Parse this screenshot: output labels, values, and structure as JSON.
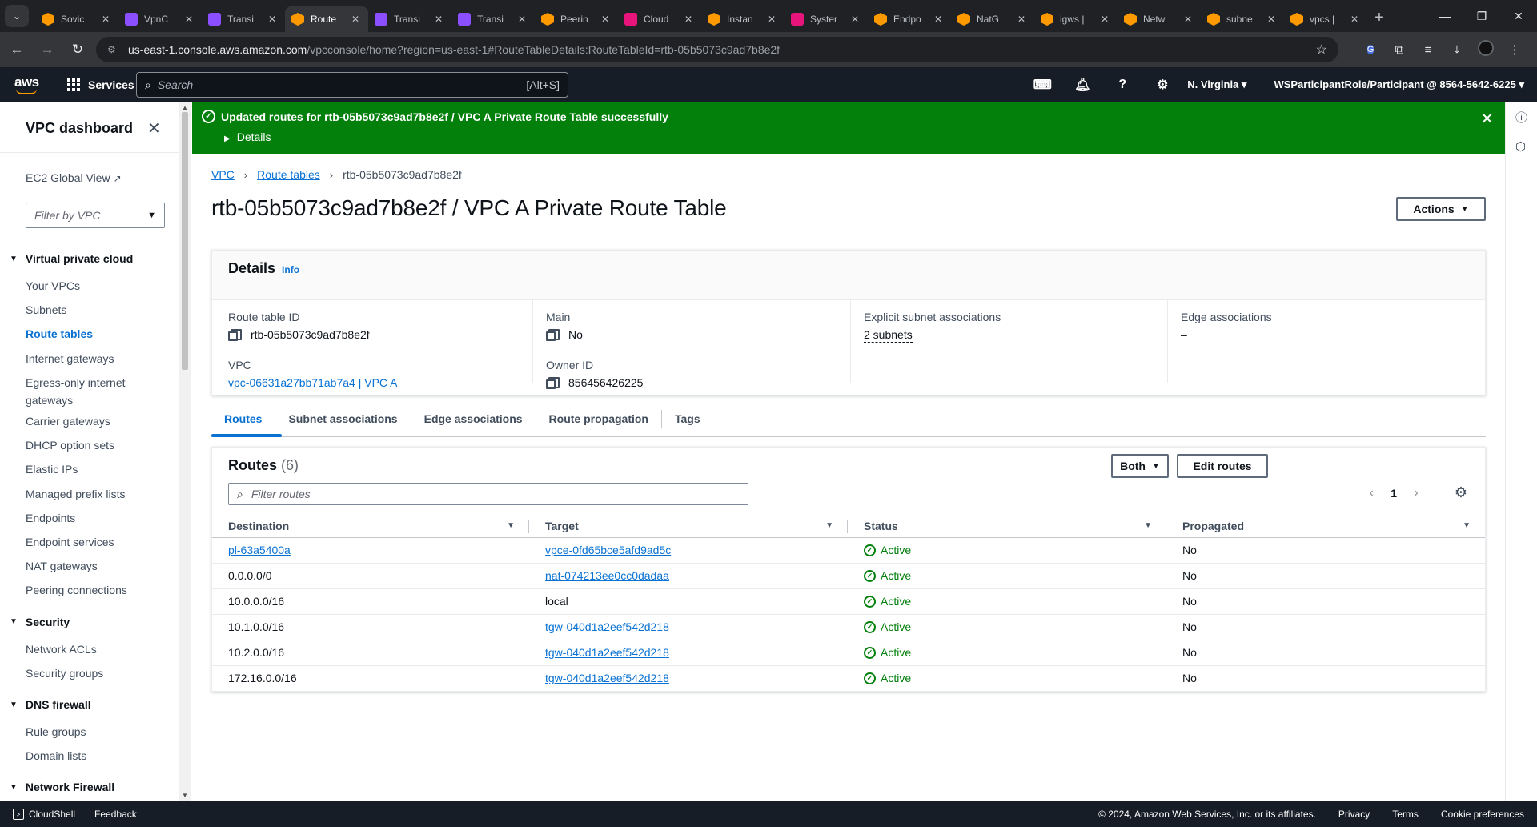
{
  "browser": {
    "tabs": [
      {
        "title": "Sovic",
        "fav": "orange"
      },
      {
        "title": "VpnC",
        "fav": "purple"
      },
      {
        "title": "Transi",
        "fav": "purple"
      },
      {
        "title": "Route",
        "fav": "orange",
        "active": true
      },
      {
        "title": "Transi",
        "fav": "purple"
      },
      {
        "title": "Transi",
        "fav": "purple"
      },
      {
        "title": "Peerin",
        "fav": "orange"
      },
      {
        "title": "Cloud",
        "fav": "pink"
      },
      {
        "title": "Instan",
        "fav": "orange"
      },
      {
        "title": "Syster",
        "fav": "pink"
      },
      {
        "title": "Endpo",
        "fav": "orange"
      },
      {
        "title": "NatG",
        "fav": "orange"
      },
      {
        "title": "igws |",
        "fav": "orange"
      },
      {
        "title": "Netw",
        "fav": "orange"
      },
      {
        "title": "subne",
        "fav": "orange"
      },
      {
        "title": "vpcs |",
        "fav": "orange"
      }
    ],
    "url_host": "us-east-1.console.aws.amazon.com",
    "url_path": "/vpcconsole/home?region=us-east-1#RouteTableDetails:RouteTableId=rtb-05b5073c9ad7b8e2f"
  },
  "awsnav": {
    "logo": "aws",
    "services": "Services",
    "search_placeholder": "Search",
    "search_hint": "[Alt+S]",
    "region": "N. Virginia",
    "account": "WSParticipantRole/Participant @ 8564-5642-6225"
  },
  "sidebar": {
    "title": "VPC dashboard",
    "ec2_global_view": "EC2 Global View",
    "filter_placeholder": "Filter by VPC",
    "sections": [
      {
        "label": "Virtual private cloud",
        "items": [
          "Your VPCs",
          "Subnets",
          "Route tables",
          "Internet gateways",
          "Egress-only internet gateways",
          "Carrier gateways",
          "DHCP option sets",
          "Elastic IPs",
          "Managed prefix lists",
          "Endpoints",
          "Endpoint services",
          "NAT gateways",
          "Peering connections"
        ]
      },
      {
        "label": "Security",
        "items": [
          "Network ACLs",
          "Security groups"
        ]
      },
      {
        "label": "DNS firewall",
        "items": [
          "Rule groups",
          "Domain lists"
        ]
      },
      {
        "label": "Network Firewall",
        "items": []
      }
    ],
    "active_item": "Route tables"
  },
  "flash": {
    "message": "Updated routes for rtb-05b5073c9ad7b8e2f / VPC A Private Route Table successfully",
    "details": "Details",
    "color": "#037f0c"
  },
  "breadcrumb": {
    "vpc": "VPC",
    "route_tables": "Route tables",
    "current": "rtb-05b5073c9ad7b8e2f"
  },
  "page": {
    "title": "rtb-05b5073c9ad7b8e2f / VPC A Private Route Table",
    "actions": "Actions"
  },
  "details": {
    "heading": "Details",
    "info": "Info",
    "route_table_id_label": "Route table ID",
    "route_table_id": "rtb-05b5073c9ad7b8e2f",
    "vpc_label": "VPC",
    "vpc": "vpc-06631a27bb71ab7a4 | VPC A",
    "main_label": "Main",
    "main": "No",
    "owner_label": "Owner ID",
    "owner": "856456426225",
    "explicit_label": "Explicit subnet associations",
    "explicit": "2 subnets",
    "edge_label": "Edge associations",
    "edge": "–"
  },
  "tabs": [
    "Routes",
    "Subnet associations",
    "Edge associations",
    "Route propagation",
    "Tags"
  ],
  "routes": {
    "title": "Routes",
    "count": "(6)",
    "both": "Both",
    "edit": "Edit routes",
    "filter_placeholder": "Filter routes",
    "page": "1",
    "columns": [
      "Destination",
      "Target",
      "Status",
      "Propagated"
    ],
    "rows": [
      {
        "destination": "pl-63a5400a",
        "dest_link": true,
        "target": "vpce-0fd65bce5afd9ad5c",
        "target_link": true,
        "status": "Active",
        "propagated": "No"
      },
      {
        "destination": "0.0.0.0/0",
        "dest_link": false,
        "target": "nat-074213ee0cc0dadaa",
        "target_link": true,
        "status": "Active",
        "propagated": "No"
      },
      {
        "destination": "10.0.0.0/16",
        "dest_link": false,
        "target": "local",
        "target_link": false,
        "status": "Active",
        "propagated": "No"
      },
      {
        "destination": "10.1.0.0/16",
        "dest_link": false,
        "target": "tgw-040d1a2eef542d218",
        "target_link": true,
        "status": "Active",
        "propagated": "No"
      },
      {
        "destination": "10.2.0.0/16",
        "dest_link": false,
        "target": "tgw-040d1a2eef542d218",
        "target_link": true,
        "status": "Active",
        "propagated": "No"
      },
      {
        "destination": "172.16.0.0/16",
        "dest_link": false,
        "target": "tgw-040d1a2eef542d218",
        "target_link": true,
        "status": "Active",
        "propagated": "No"
      }
    ]
  },
  "footer": {
    "cloudshell": "CloudShell",
    "feedback": "Feedback",
    "copyright": "© 2024, Amazon Web Services, Inc. or its affiliates.",
    "privacy": "Privacy",
    "terms": "Terms",
    "cookies": "Cookie preferences"
  }
}
